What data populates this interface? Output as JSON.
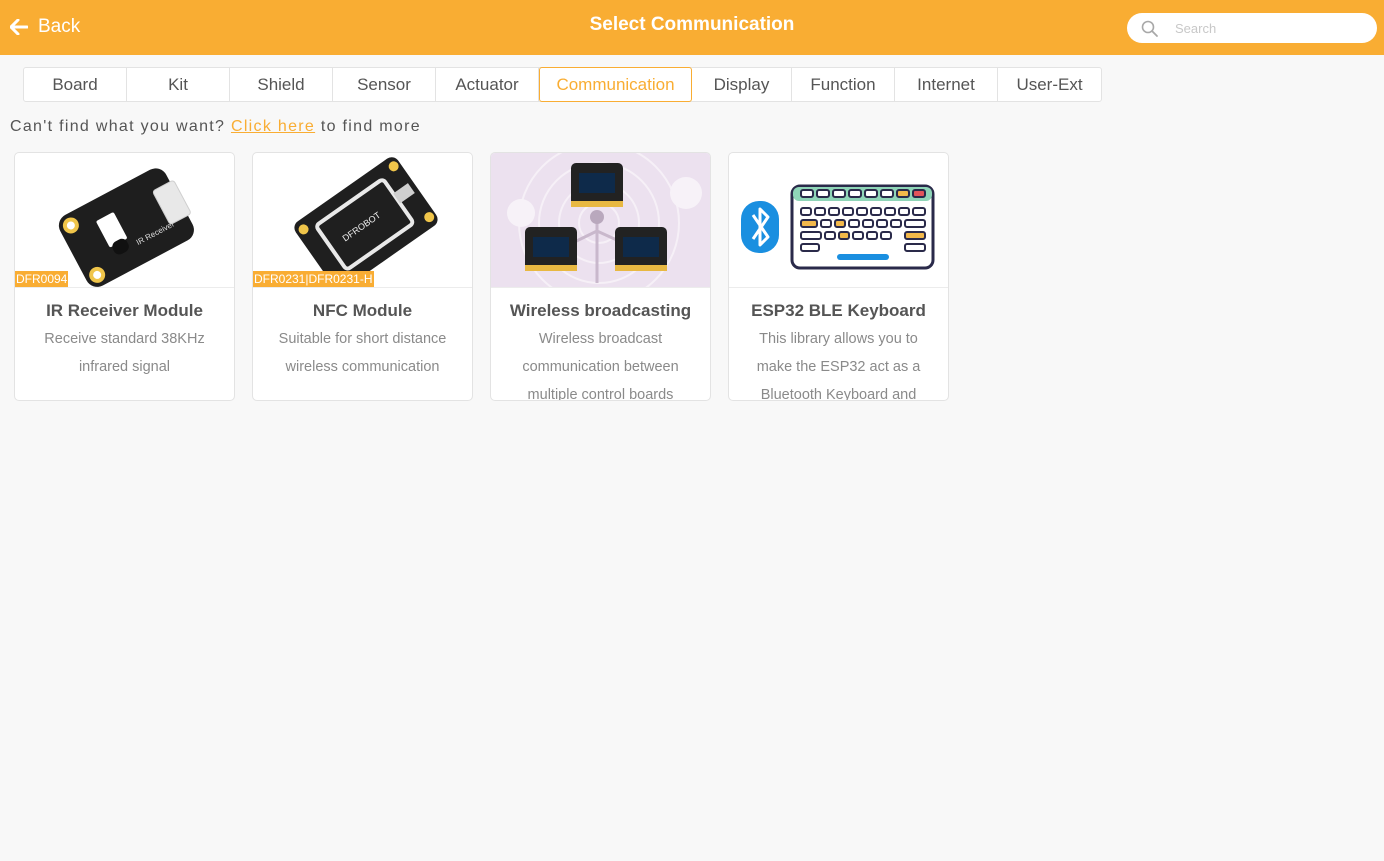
{
  "header": {
    "back_label": "Back",
    "title": "Select Communication",
    "search_placeholder": "Search",
    "color": "#f9ad33"
  },
  "tabs": [
    {
      "label": "Board"
    },
    {
      "label": "Kit"
    },
    {
      "label": "Shield"
    },
    {
      "label": "Sensor"
    },
    {
      "label": "Actuator"
    },
    {
      "label": "Communication",
      "active": true
    },
    {
      "label": "Display"
    },
    {
      "label": "Function"
    },
    {
      "label": "Internet"
    },
    {
      "label": "User-Ext"
    }
  ],
  "hint": {
    "prefix": "Can't find what you want?",
    "link": "Click here",
    "suffix": "to find more"
  },
  "cards": [
    {
      "name": "IR Receiver Module",
      "description": "Receive standard 38KHz infrared signal",
      "tag": "DFR0094",
      "icon": "ir-receiver-board-image"
    },
    {
      "name": "NFC Module",
      "description": "Suitable for short distance wireless communication",
      "tag": "DFR0231|DFR0231-H",
      "icon": "nfc-board-image"
    },
    {
      "name": "Wireless broadcasting",
      "description": "Wireless broadcast communication between multiple control boards",
      "icon": "wireless-broadcast-image"
    },
    {
      "name": "ESP32 BLE Keyboard",
      "description": "This library allows you to make the ESP32 act as a Bluetooth Keyboard and",
      "icon": "bluetooth-keyboard-image"
    }
  ]
}
